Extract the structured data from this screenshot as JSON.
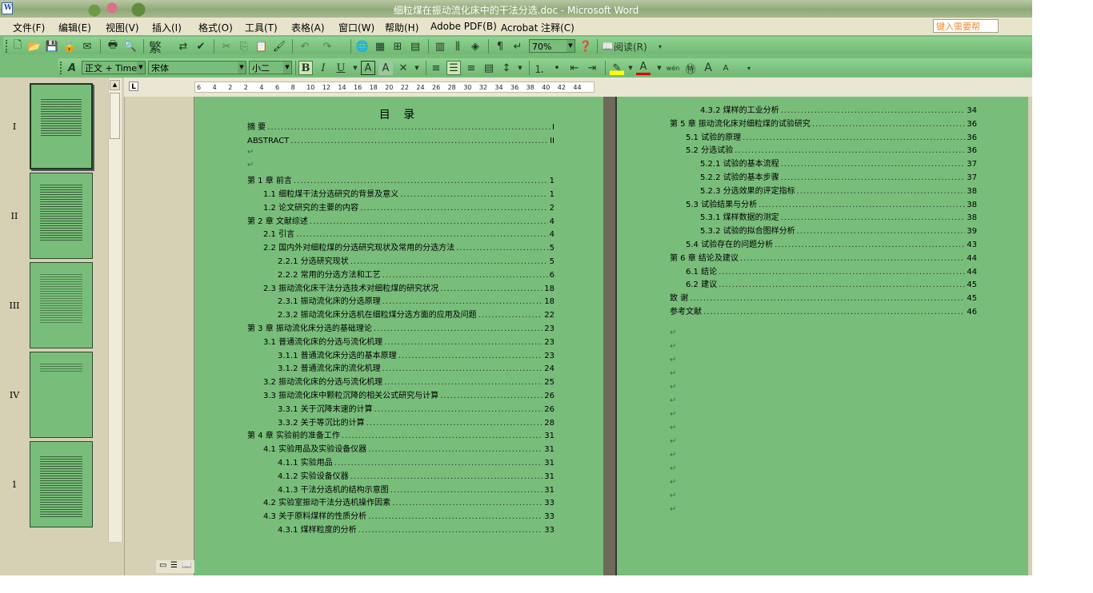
{
  "window": {
    "title": "细粒煤在振动流化床中的干法分选.doc - Microsoft Word",
    "app_icon": "word-doc-icon"
  },
  "menubar": {
    "items": [
      "文件(F)",
      "编辑(E)",
      "视图(V)",
      "插入(I)",
      "格式(O)",
      "工具(T)",
      "表格(A)",
      "窗口(W)",
      "帮助(H)",
      "Adobe PDF(B)",
      "Acrobat 注释(C)"
    ],
    "ask_placeholder": "键入需要帮"
  },
  "toolbar_standard": {
    "traditional_label": "繁",
    "zoom_value": "70%",
    "read_label": "阅读(R)"
  },
  "toolbar_format": {
    "style_value": "正文 + Time",
    "font_value": "宋体",
    "size_value": "小二",
    "bold": "B",
    "italic": "I",
    "underline": "U",
    "char_border": "A",
    "char_shade": "A",
    "font_color": "A",
    "pinyin": "wén",
    "grow_font": "A",
    "shrink_font": "A"
  },
  "ruler": {
    "corner": "L",
    "ticks": [
      "6",
      "4",
      "2",
      "2",
      "4",
      "6",
      "8",
      "10",
      "12",
      "14",
      "16",
      "18",
      "20",
      "22",
      "24",
      "26",
      "28",
      "30",
      "32",
      "34",
      "36",
      "38",
      "40",
      "42",
      "44"
    ]
  },
  "thumbnails": [
    {
      "label": "I",
      "selected": true
    },
    {
      "label": "II",
      "selected": false
    },
    {
      "label": "III",
      "selected": false
    },
    {
      "label": "IV",
      "selected": false
    },
    {
      "label": "1",
      "selected": false
    }
  ],
  "page1": {
    "title": "目 录",
    "entries": [
      {
        "text": "摘 要",
        "page": "I",
        "level": 0
      },
      {
        "text": "ABSTRACT",
        "page": "II",
        "level": 0
      },
      {
        "text": "",
        "page": "",
        "level": 0
      },
      {
        "text": "",
        "page": "",
        "level": 0
      },
      {
        "text": "第 1 章  前言",
        "page": "1",
        "level": 0
      },
      {
        "text": "1.1  细粒煤干法分选研究的背景及意义",
        "page": "1",
        "level": 1
      },
      {
        "text": "1.2  论文研究的主要的内容",
        "page": "2",
        "level": 1
      },
      {
        "text": "第 2 章  文献综述",
        "page": "4",
        "level": 0
      },
      {
        "text": "2.1  引言",
        "page": "4",
        "level": 1
      },
      {
        "text": "2.2  国内外对细粒煤的分选研究现状及常用的分选方法",
        "page": "5",
        "level": 1
      },
      {
        "text": "2.2.1  分选研究现状",
        "page": "5",
        "level": 2
      },
      {
        "text": "2.2.2  常用的分选方法和工艺",
        "page": "6",
        "level": 2
      },
      {
        "text": "2.3  振动流化床干法分选技术对细粒煤的研究状况",
        "page": "18",
        "level": 1
      },
      {
        "text": "2.3.1  振动流化床的分选原理",
        "page": "18",
        "level": 2
      },
      {
        "text": "2.3.2  振动流化床分选机在细粒煤分选方面的应用及问题",
        "page": "22",
        "level": 2
      },
      {
        "text": "第 3 章  振动流化床分选的基础理论",
        "page": "23",
        "level": 0
      },
      {
        "text": "3.1  普通流化床的分选与流化机理",
        "page": "23",
        "level": 1
      },
      {
        "text": "3.1.1  普通流化床分选的基本原理",
        "page": "23",
        "level": 2
      },
      {
        "text": "3.1.2  普通流化床的流化机理",
        "page": "24",
        "level": 2
      },
      {
        "text": "3.2  振动流化床的分选与流化机理",
        "page": "25",
        "level": 1
      },
      {
        "text": "3.3  振动流化床中颗粒沉降的相关公式研究与计算",
        "page": "26",
        "level": 1
      },
      {
        "text": "3.3.1  关于沉降末速的计算",
        "page": "26",
        "level": 2
      },
      {
        "text": "3.3.2  关于等沉比的计算",
        "page": "28",
        "level": 2
      },
      {
        "text": "第 4 章  实验前的准备工作",
        "page": "31",
        "level": 0
      },
      {
        "text": "4.1  实验用品及实验设备仪器",
        "page": "31",
        "level": 1
      },
      {
        "text": "4.1.1  实验用品",
        "page": "31",
        "level": 2
      },
      {
        "text": "4.1.2  实验设备仪器",
        "page": "31",
        "level": 2
      },
      {
        "text": "4.1.3 干法分选机的结构示意图",
        "page": "31",
        "level": 2
      },
      {
        "text": "4.2 实验室振动干法分选机操作因素",
        "page": "33",
        "level": 1
      },
      {
        "text": "4.3  关于原料煤样的性质分析",
        "page": "33",
        "level": 1
      },
      {
        "text": "4.3.1  煤样粒度的分析",
        "page": "33",
        "level": 2
      }
    ]
  },
  "page2": {
    "entries": [
      {
        "text": "4.3.2  煤样的工业分析",
        "page": "34",
        "level": 2
      },
      {
        "text": "第 5 章  振动流化床对细粒煤的试验研究",
        "page": "36",
        "level": 0
      },
      {
        "text": "5.1  试验的原理",
        "page": "36",
        "level": 1
      },
      {
        "text": "5.2  分选试验",
        "page": "36",
        "level": 1
      },
      {
        "text": "5.2.1  试验的基本流程",
        "page": "37",
        "level": 2
      },
      {
        "text": "5.2.2  试验的基本步骤",
        "page": "37",
        "level": 2
      },
      {
        "text": "5.2.3  分选效果的评定指标",
        "page": "38",
        "level": 2
      },
      {
        "text": "5.3 试验结果与分析",
        "page": "38",
        "level": 1
      },
      {
        "text": "5.3.1 煤样数据的测定",
        "page": "38",
        "level": 2
      },
      {
        "text": "5.3.2 试验的拟合图样分析",
        "page": "39",
        "level": 2
      },
      {
        "text": "5.4 试验存在的问题分析",
        "page": "43",
        "level": 1
      },
      {
        "text": "第 6 章  结论及建议",
        "page": "44",
        "level": 0
      },
      {
        "text": "6.1 结论",
        "page": "44",
        "level": 1
      },
      {
        "text": "6.2 建议",
        "page": "45",
        "level": 1
      },
      {
        "text": "致  谢",
        "page": "45",
        "level": 0
      },
      {
        "text": "参考文献",
        "page": "46",
        "level": 0
      }
    ]
  },
  "colors": {
    "page_green": "#79bd7b",
    "chrome_beige": "#d6d0b4",
    "menubar": "#e8e4cc"
  }
}
